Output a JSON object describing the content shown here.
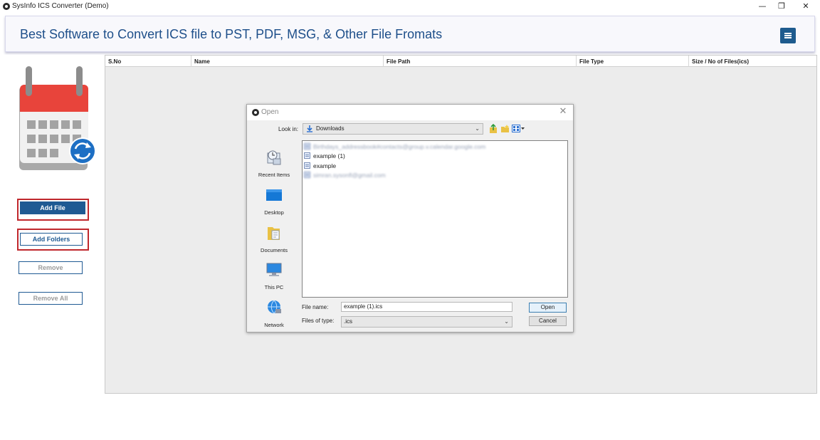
{
  "window": {
    "title": "SysInfo ICS Converter (Demo)",
    "minimize": "—",
    "restore": "❐",
    "close": "✕"
  },
  "banner": {
    "headline": "Best Software to Convert ICS file to PST, PDF, MSG, & Other File Fromats"
  },
  "sidebar": {
    "add_file": "Add File",
    "add_folders": "Add Folders",
    "remove": "Remove",
    "remove_all": "Remove All"
  },
  "grid": {
    "columns": [
      "S.No",
      "Name",
      "File Path",
      "File Type",
      "Size / No of Files(ics)"
    ]
  },
  "dialog": {
    "title": "Open",
    "close": "✕",
    "look_in_label": "Look in:",
    "look_in_value": "Downloads",
    "places": [
      "Recent Items",
      "Desktop",
      "Documents",
      "This PC",
      "Network"
    ],
    "files": [
      {
        "name": "Birthdays_addressbook#contacts@group.v.calendar.google.com",
        "blurred": true
      },
      {
        "name": "example (1)",
        "blurred": false
      },
      {
        "name": "example",
        "blurred": false
      },
      {
        "name": "simran.sysonfl@gmail.com",
        "blurred": true
      }
    ],
    "file_name_label": "File name:",
    "file_name_value": "example (1).ics",
    "file_type_label": "Files of type:",
    "file_type_value": ".ics",
    "open_button": "Open",
    "cancel_button": "Cancel"
  },
  "colors": {
    "accent": "#1f5a93",
    "headline": "#1e4f8a",
    "highlight_frame": "#c0282d"
  }
}
